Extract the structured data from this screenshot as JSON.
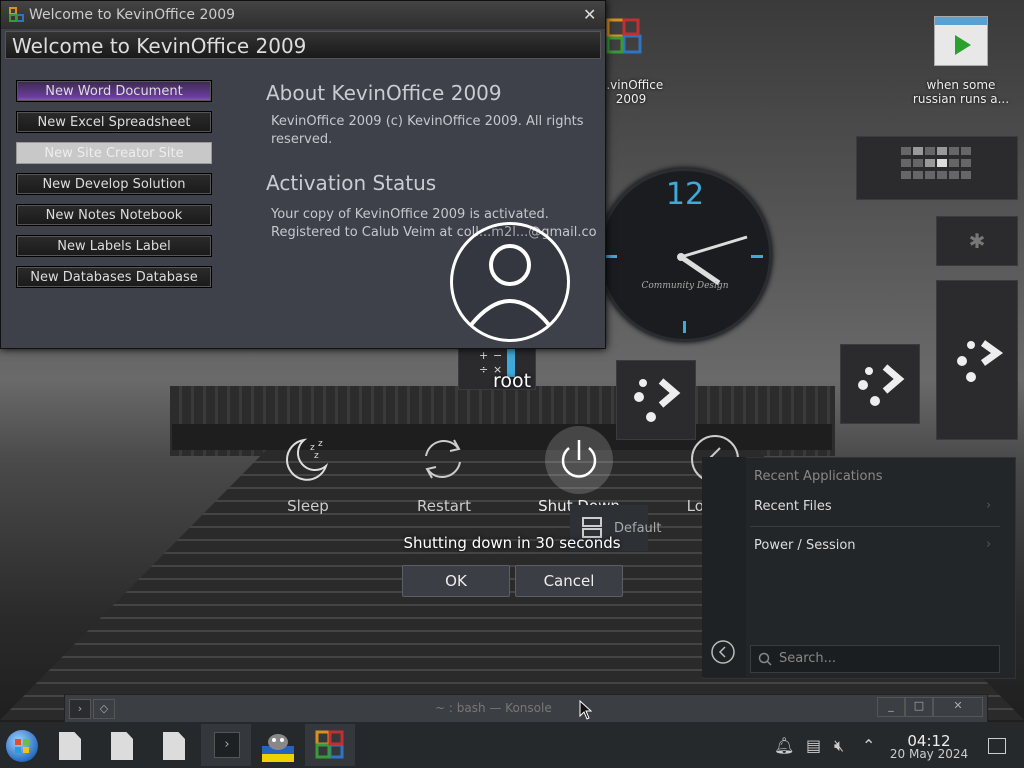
{
  "office_window": {
    "titlebar": "Welcome to KevinOffice 2009",
    "heading": "Welcome to KevinOffice 2009",
    "buttons": [
      {
        "label": "New Word Document"
      },
      {
        "label": "New Excel Spreadsheet"
      },
      {
        "label": "New Site Creator Site"
      },
      {
        "label": "New Develop Solution"
      },
      {
        "label": "New Notes Notebook"
      },
      {
        "label": "New Labels Label"
      },
      {
        "label": "New Databases Database"
      }
    ],
    "about_title": "About KevinOffice 2009",
    "about_text": "KevinOffice 2009 (c) KevinOffice 2009. All rights reserved.",
    "activation_title": "Activation Status",
    "activation_line1": "Your copy of KevinOffice 2009 is activated.",
    "activation_line2": "Registered to Calub Veim at coll...m2l...@gmail.co"
  },
  "desktop": {
    "icon_office_label": "...vinOffice 2009",
    "icon_video_label": "when some russian runs a...",
    "clock_number": "12",
    "clock_brand": "Community Design"
  },
  "logout": {
    "username": "root",
    "actions": [
      {
        "label": "Sleep",
        "icon": "sleep-icon"
      },
      {
        "label": "Restart",
        "icon": "restart-icon"
      },
      {
        "label": "Shut Down",
        "icon": "power-icon"
      },
      {
        "label": "Log Out",
        "icon": "logout-icon"
      }
    ],
    "session_default": "Default",
    "countdown": "Shutting down in 30 seconds",
    "ok": "OK",
    "cancel": "Cancel"
  },
  "menu": {
    "items": [
      "Recent Applications",
      "Recent Files",
      "Power / Session"
    ],
    "search_placeholder": "Search..."
  },
  "konsole": {
    "title": "~ : bash — Konsole"
  },
  "taskbar": {
    "time": "04:12",
    "date": "20 May 2024"
  },
  "colors": {
    "accent": "#3fa9d9",
    "purple": "#6b3d9c"
  }
}
